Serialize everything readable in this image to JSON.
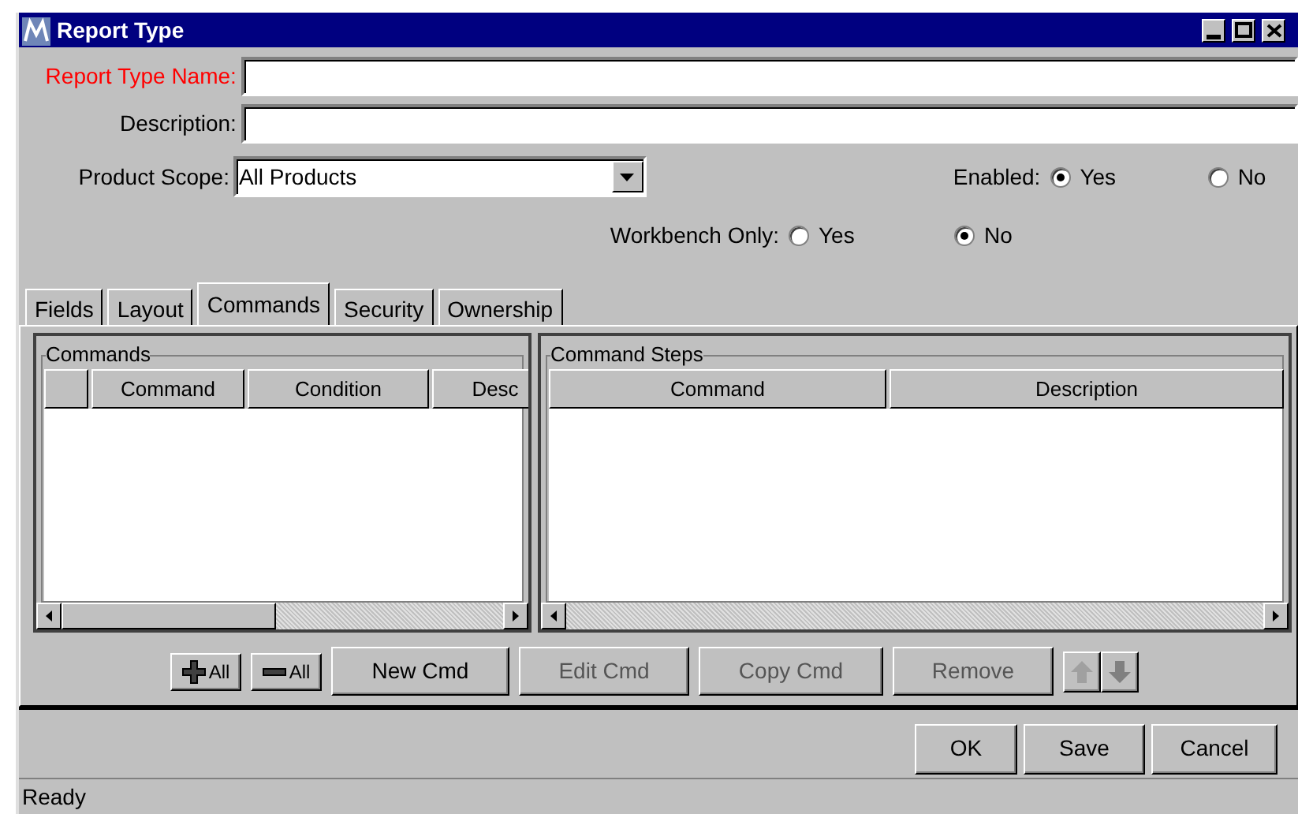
{
  "window": {
    "title": "Report Type"
  },
  "fields": [
    {
      "label": "Report Type Name:",
      "required": true
    },
    {
      "label": "Description:",
      "required": false
    }
  ],
  "product_scope": {
    "label": "Product Scope:",
    "value": "All Products"
  },
  "radio_groups": [
    {
      "label": "Enabled:",
      "options": [
        {
          "label": "Yes",
          "selected": true
        },
        {
          "label": "No",
          "selected": false
        }
      ]
    },
    {
      "label": "Workbench Only:",
      "options": [
        {
          "label": "Yes",
          "selected": false
        },
        {
          "label": "No",
          "selected": true
        }
      ]
    }
  ],
  "tabs": [
    {
      "label": "Fields",
      "selected": false
    },
    {
      "label": "Layout",
      "selected": false
    },
    {
      "label": "Commands",
      "selected": true
    },
    {
      "label": "Security",
      "selected": false
    },
    {
      "label": "Ownership",
      "selected": false
    }
  ],
  "commands_panel": {
    "title": "Commands",
    "columns": [
      {
        "kind": "blank"
      },
      {
        "kind": "text",
        "label": "Command"
      },
      {
        "kind": "text",
        "label": "Condition"
      },
      {
        "kind": "text",
        "label": "Desc"
      }
    ]
  },
  "steps_panel": {
    "title": "Command Steps",
    "columns": [
      {
        "kind": "text",
        "label": "Command"
      },
      {
        "kind": "text",
        "label": "Description"
      }
    ]
  },
  "toolbar": [
    {
      "kind": "plus",
      "label": "All",
      "disabled": false
    },
    {
      "kind": "minus",
      "label": "All",
      "disabled": false
    },
    {
      "kind": "text",
      "label": "New Cmd",
      "disabled": false
    },
    {
      "kind": "text",
      "label": "Edit Cmd",
      "disabled": true
    },
    {
      "kind": "text",
      "label": "Copy Cmd",
      "disabled": true
    },
    {
      "kind": "text",
      "label": "Remove",
      "disabled": true
    },
    {
      "kind": "up",
      "disabled": true
    },
    {
      "kind": "down",
      "disabled": false
    }
  ],
  "dialog_buttons": [
    "OK",
    "Save",
    "Cancel"
  ],
  "status_bar": "Ready"
}
